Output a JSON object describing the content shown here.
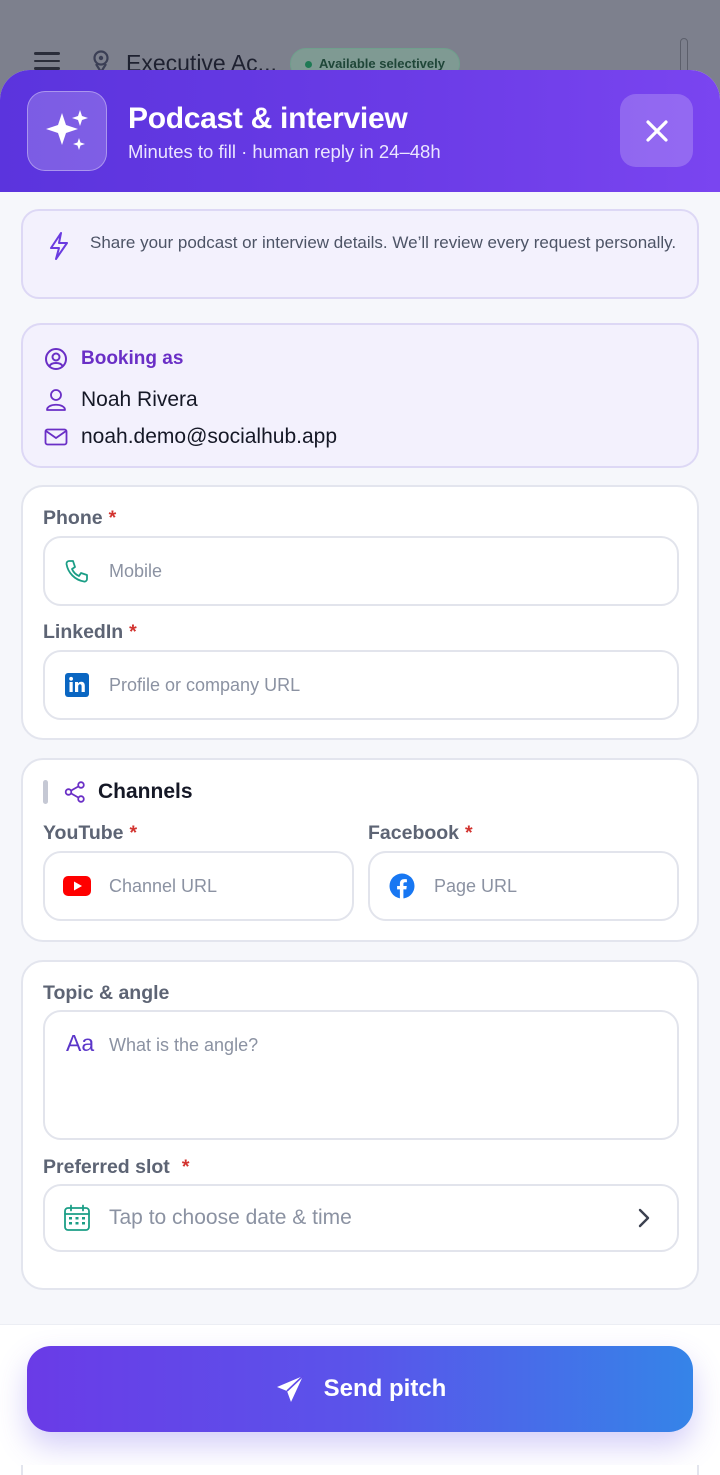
{
  "background": {
    "title": "Executive Ac...",
    "status_badge": "Available selectively"
  },
  "header": {
    "title": "Podcast & interview",
    "subtitle": "Minutes to fill · human reply in 24–48h",
    "icon": "sparkles-icon",
    "close_icon": "close-icon",
    "gradient_start": "#5b34dd",
    "gradient_end": "#7a45f0"
  },
  "note": {
    "text": "Share your podcast or interview details. We’ll review every request personally."
  },
  "booking": {
    "heading": "Booking as",
    "name": "Noah Rivera",
    "email": "noah.demo@socialhub.app"
  },
  "contact": {
    "phone_label": "Phone",
    "phone_placeholder": "Mobile",
    "linkedin_label": "LinkedIn",
    "linkedin_placeholder": "Profile or company URL",
    "required_mark": "*"
  },
  "channels": {
    "title": "Channels",
    "youtube_label": "YouTube",
    "youtube_placeholder": "Channel URL",
    "facebook_label": "Facebook",
    "facebook_placeholder": "Page URL"
  },
  "topic": {
    "label": "Topic & angle",
    "icon_text": "Aa",
    "placeholder": "What is the angle?",
    "slot_label": "Preferred slot",
    "slot_placeholder": "Tap to choose date & time"
  },
  "footer": {
    "send_label": "Send pitch",
    "accent": "#6a3be7",
    "accent_end": "#3584e8"
  }
}
